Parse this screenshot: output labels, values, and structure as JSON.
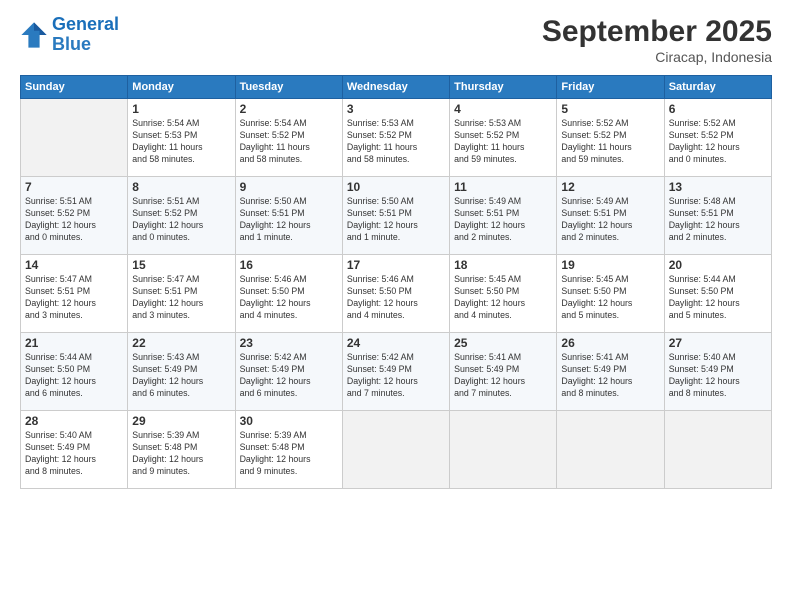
{
  "header": {
    "logo_line1": "General",
    "logo_line2": "Blue",
    "month_title": "September 2025",
    "subtitle": "Ciracap, Indonesia"
  },
  "weekdays": [
    "Sunday",
    "Monday",
    "Tuesday",
    "Wednesday",
    "Thursday",
    "Friday",
    "Saturday"
  ],
  "weeks": [
    [
      {
        "day": "",
        "info": ""
      },
      {
        "day": "1",
        "info": "Sunrise: 5:54 AM\nSunset: 5:53 PM\nDaylight: 11 hours\nand 58 minutes."
      },
      {
        "day": "2",
        "info": "Sunrise: 5:54 AM\nSunset: 5:52 PM\nDaylight: 11 hours\nand 58 minutes."
      },
      {
        "day": "3",
        "info": "Sunrise: 5:53 AM\nSunset: 5:52 PM\nDaylight: 11 hours\nand 58 minutes."
      },
      {
        "day": "4",
        "info": "Sunrise: 5:53 AM\nSunset: 5:52 PM\nDaylight: 11 hours\nand 59 minutes."
      },
      {
        "day": "5",
        "info": "Sunrise: 5:52 AM\nSunset: 5:52 PM\nDaylight: 11 hours\nand 59 minutes."
      },
      {
        "day": "6",
        "info": "Sunrise: 5:52 AM\nSunset: 5:52 PM\nDaylight: 12 hours\nand 0 minutes."
      }
    ],
    [
      {
        "day": "7",
        "info": "Sunrise: 5:51 AM\nSunset: 5:52 PM\nDaylight: 12 hours\nand 0 minutes."
      },
      {
        "day": "8",
        "info": "Sunrise: 5:51 AM\nSunset: 5:52 PM\nDaylight: 12 hours\nand 0 minutes."
      },
      {
        "day": "9",
        "info": "Sunrise: 5:50 AM\nSunset: 5:51 PM\nDaylight: 12 hours\nand 1 minute."
      },
      {
        "day": "10",
        "info": "Sunrise: 5:50 AM\nSunset: 5:51 PM\nDaylight: 12 hours\nand 1 minute."
      },
      {
        "day": "11",
        "info": "Sunrise: 5:49 AM\nSunset: 5:51 PM\nDaylight: 12 hours\nand 2 minutes."
      },
      {
        "day": "12",
        "info": "Sunrise: 5:49 AM\nSunset: 5:51 PM\nDaylight: 12 hours\nand 2 minutes."
      },
      {
        "day": "13",
        "info": "Sunrise: 5:48 AM\nSunset: 5:51 PM\nDaylight: 12 hours\nand 2 minutes."
      }
    ],
    [
      {
        "day": "14",
        "info": "Sunrise: 5:47 AM\nSunset: 5:51 PM\nDaylight: 12 hours\nand 3 minutes."
      },
      {
        "day": "15",
        "info": "Sunrise: 5:47 AM\nSunset: 5:51 PM\nDaylight: 12 hours\nand 3 minutes."
      },
      {
        "day": "16",
        "info": "Sunrise: 5:46 AM\nSunset: 5:50 PM\nDaylight: 12 hours\nand 4 minutes."
      },
      {
        "day": "17",
        "info": "Sunrise: 5:46 AM\nSunset: 5:50 PM\nDaylight: 12 hours\nand 4 minutes."
      },
      {
        "day": "18",
        "info": "Sunrise: 5:45 AM\nSunset: 5:50 PM\nDaylight: 12 hours\nand 4 minutes."
      },
      {
        "day": "19",
        "info": "Sunrise: 5:45 AM\nSunset: 5:50 PM\nDaylight: 12 hours\nand 5 minutes."
      },
      {
        "day": "20",
        "info": "Sunrise: 5:44 AM\nSunset: 5:50 PM\nDaylight: 12 hours\nand 5 minutes."
      }
    ],
    [
      {
        "day": "21",
        "info": "Sunrise: 5:44 AM\nSunset: 5:50 PM\nDaylight: 12 hours\nand 6 minutes."
      },
      {
        "day": "22",
        "info": "Sunrise: 5:43 AM\nSunset: 5:49 PM\nDaylight: 12 hours\nand 6 minutes."
      },
      {
        "day": "23",
        "info": "Sunrise: 5:42 AM\nSunset: 5:49 PM\nDaylight: 12 hours\nand 6 minutes."
      },
      {
        "day": "24",
        "info": "Sunrise: 5:42 AM\nSunset: 5:49 PM\nDaylight: 12 hours\nand 7 minutes."
      },
      {
        "day": "25",
        "info": "Sunrise: 5:41 AM\nSunset: 5:49 PM\nDaylight: 12 hours\nand 7 minutes."
      },
      {
        "day": "26",
        "info": "Sunrise: 5:41 AM\nSunset: 5:49 PM\nDaylight: 12 hours\nand 8 minutes."
      },
      {
        "day": "27",
        "info": "Sunrise: 5:40 AM\nSunset: 5:49 PM\nDaylight: 12 hours\nand 8 minutes."
      }
    ],
    [
      {
        "day": "28",
        "info": "Sunrise: 5:40 AM\nSunset: 5:49 PM\nDaylight: 12 hours\nand 8 minutes."
      },
      {
        "day": "29",
        "info": "Sunrise: 5:39 AM\nSunset: 5:48 PM\nDaylight: 12 hours\nand 9 minutes."
      },
      {
        "day": "30",
        "info": "Sunrise: 5:39 AM\nSunset: 5:48 PM\nDaylight: 12 hours\nand 9 minutes."
      },
      {
        "day": "",
        "info": ""
      },
      {
        "day": "",
        "info": ""
      },
      {
        "day": "",
        "info": ""
      },
      {
        "day": "",
        "info": ""
      }
    ]
  ]
}
